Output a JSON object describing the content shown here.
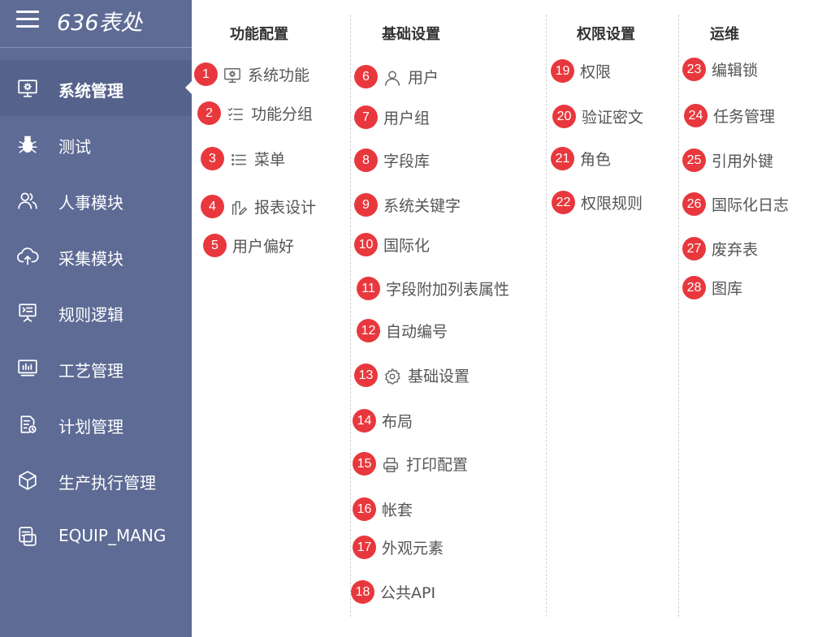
{
  "app": {
    "title": "636表处"
  },
  "sidebar": {
    "items": [
      {
        "label": "系统管理",
        "icon": "monitor-gear-icon",
        "active": true
      },
      {
        "label": "测试",
        "icon": "bug-icon",
        "active": false
      },
      {
        "label": "人事模块",
        "icon": "users-icon",
        "active": false
      },
      {
        "label": "采集模块",
        "icon": "cloud-upload-icon",
        "active": false
      },
      {
        "label": "规则逻辑",
        "icon": "presentation-board-icon",
        "active": false
      },
      {
        "label": "工艺管理",
        "icon": "bar-chart-icon",
        "active": false
      },
      {
        "label": "计划管理",
        "icon": "document-clock-icon",
        "active": false
      },
      {
        "label": "生产执行管理",
        "icon": "box-icon",
        "active": false
      },
      {
        "label": "EQUIP_MANG",
        "icon": "layers-icon",
        "active": false
      }
    ]
  },
  "columns": [
    {
      "title": "功能配置",
      "items": [
        {
          "num": "1",
          "label": "系统功能",
          "icon": "monitor-gear-icon"
        },
        {
          "num": "2",
          "label": "功能分组",
          "icon": "checklist-icon"
        },
        {
          "num": "3",
          "label": "菜单",
          "icon": "list-icon"
        },
        {
          "num": "4",
          "label": "报表设计",
          "icon": "report-edit-icon"
        },
        {
          "num": "5",
          "label": "用户偏好",
          "icon": ""
        }
      ]
    },
    {
      "title": "基础设置",
      "items": [
        {
          "num": "6",
          "label": "用户",
          "icon": "user-icon"
        },
        {
          "num": "7",
          "label": "用户组",
          "icon": ""
        },
        {
          "num": "8",
          "label": "字段库",
          "icon": ""
        },
        {
          "num": "9",
          "label": "系统关键字",
          "icon": ""
        },
        {
          "num": "10",
          "label": "国际化",
          "icon": ""
        },
        {
          "num": "11",
          "label": "字段附加列表属性",
          "icon": ""
        },
        {
          "num": "12",
          "label": "自动编号",
          "icon": ""
        },
        {
          "num": "13",
          "label": "基础设置",
          "icon": "gear-icon"
        },
        {
          "num": "14",
          "label": "布局",
          "icon": ""
        },
        {
          "num": "15",
          "label": "打印配置",
          "icon": "printer-icon"
        },
        {
          "num": "16",
          "label": "帐套",
          "icon": ""
        },
        {
          "num": "17",
          "label": "外观元素",
          "icon": ""
        },
        {
          "num": "18",
          "label": "公共API",
          "icon": ""
        }
      ]
    },
    {
      "title": "权限设置",
      "items": [
        {
          "num": "19",
          "label": "权限",
          "icon": ""
        },
        {
          "num": "20",
          "label": "验证密文",
          "icon": ""
        },
        {
          "num": "21",
          "label": "角色",
          "icon": ""
        },
        {
          "num": "22",
          "label": "权限规则",
          "icon": ""
        }
      ]
    },
    {
      "title": "运维",
      "items": [
        {
          "num": "23",
          "label": "编辑锁",
          "icon": ""
        },
        {
          "num": "24",
          "label": "任务管理",
          "icon": ""
        },
        {
          "num": "25",
          "label": "引用外键",
          "icon": ""
        },
        {
          "num": "26",
          "label": "国际化日志",
          "icon": ""
        },
        {
          "num": "27",
          "label": "废弃表",
          "icon": ""
        },
        {
          "num": "28",
          "label": "图库",
          "icon": ""
        }
      ]
    }
  ],
  "colors": {
    "sidebar": "#5d6b95",
    "sidebar_active": "#55638c",
    "badge": "#e8383d",
    "text": "#555555"
  }
}
